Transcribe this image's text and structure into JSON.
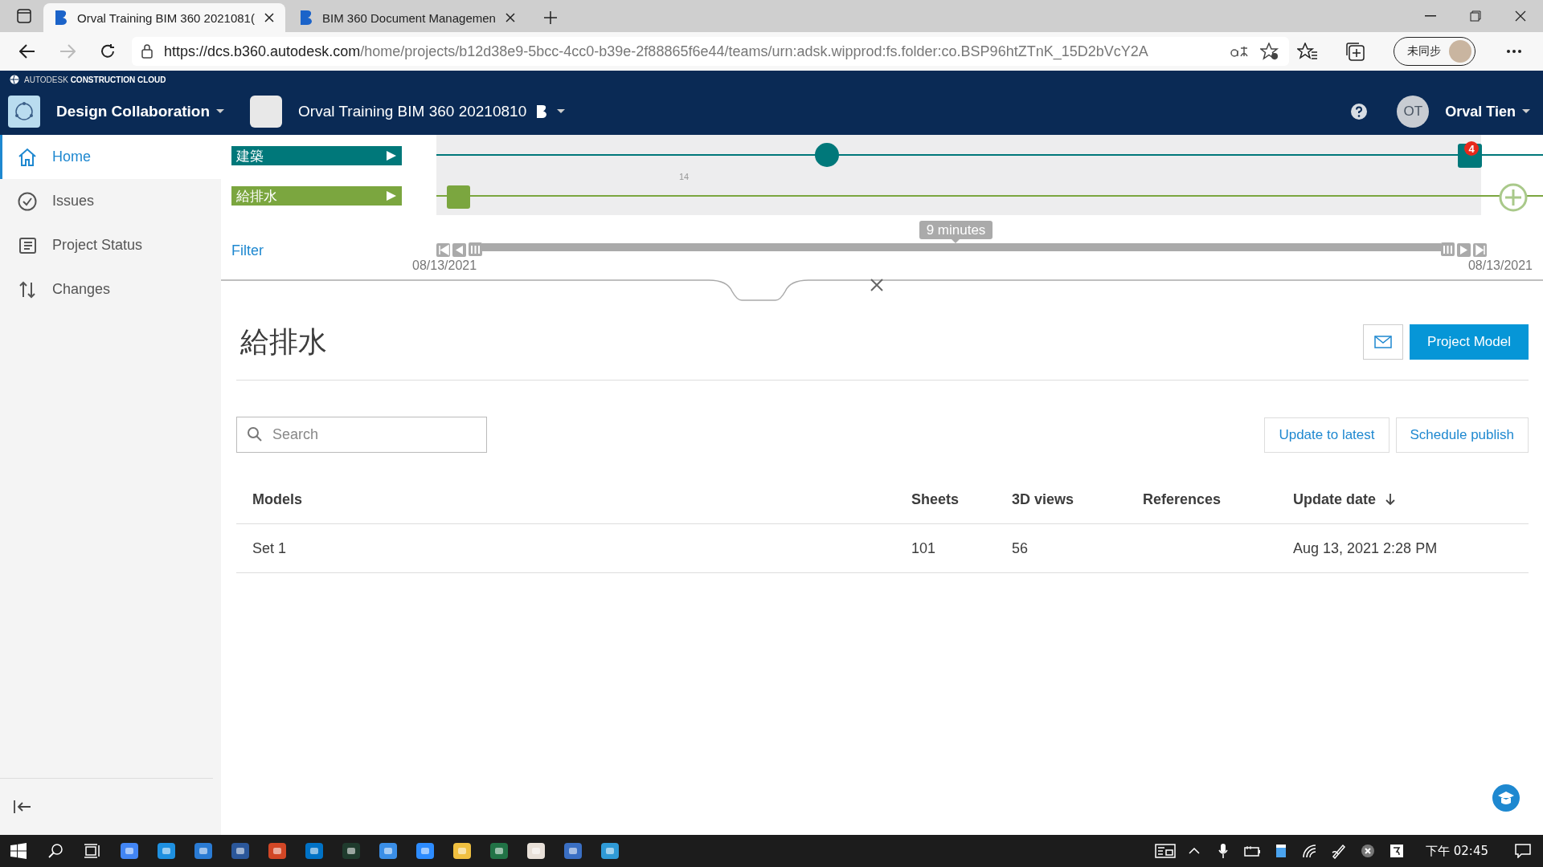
{
  "browser": {
    "tabs": [
      {
        "title": "Orval Training BIM 360 2021081(",
        "selected": true
      },
      {
        "title": "BIM 360 Document Managemen",
        "selected": false
      }
    ],
    "url_host": "https://dcs.b360.autodesk.com",
    "url_path": "/home/projects/b12d38e9-5bcc-4cc0-b39e-2f88865f6e44/teams/urn:adsk.wipprod:fs.folder:co.BSP96htZTnK_15D2bVcY2A",
    "profile_label": "未同步"
  },
  "app": {
    "brand": "AUTODESK",
    "brand_sub": "CONSTRUCTION CLOUD",
    "module": "Design Collaboration",
    "project": "Orval Training BIM 360 20210810",
    "user_initials": "OT",
    "user_name": "Orval Tien"
  },
  "sidebar": {
    "items": [
      {
        "label": "Home",
        "selected": true
      },
      {
        "label": "Issues",
        "selected": false
      },
      {
        "label": "Project Status",
        "selected": false
      },
      {
        "label": "Changes",
        "selected": false
      }
    ]
  },
  "timeline": {
    "tracks": [
      {
        "label": "建築",
        "color": "#00787a"
      },
      {
        "label": "給排水",
        "color": "#7ba63f"
      }
    ],
    "filter": "Filter",
    "tick_label": "14",
    "badge": "4",
    "tooltip": "9 minutes",
    "start_date": "08/13/2021",
    "end_date": "08/13/2021"
  },
  "package": {
    "title": "給排水",
    "primary_button": "Project Model",
    "search": {
      "placeholder": "Search"
    },
    "buttons": [
      "Update to latest",
      "Schedule publish"
    ]
  },
  "table": {
    "columns": [
      "Models",
      "Sheets",
      "3D views",
      "References",
      "Update date"
    ],
    "rows": [
      {
        "cells": [
          "Set 1",
          "101",
          "56",
          "",
          "Aug 13, 2021 2:28 PM"
        ]
      }
    ]
  },
  "taskbar": {
    "clock": "下午 02:45"
  }
}
